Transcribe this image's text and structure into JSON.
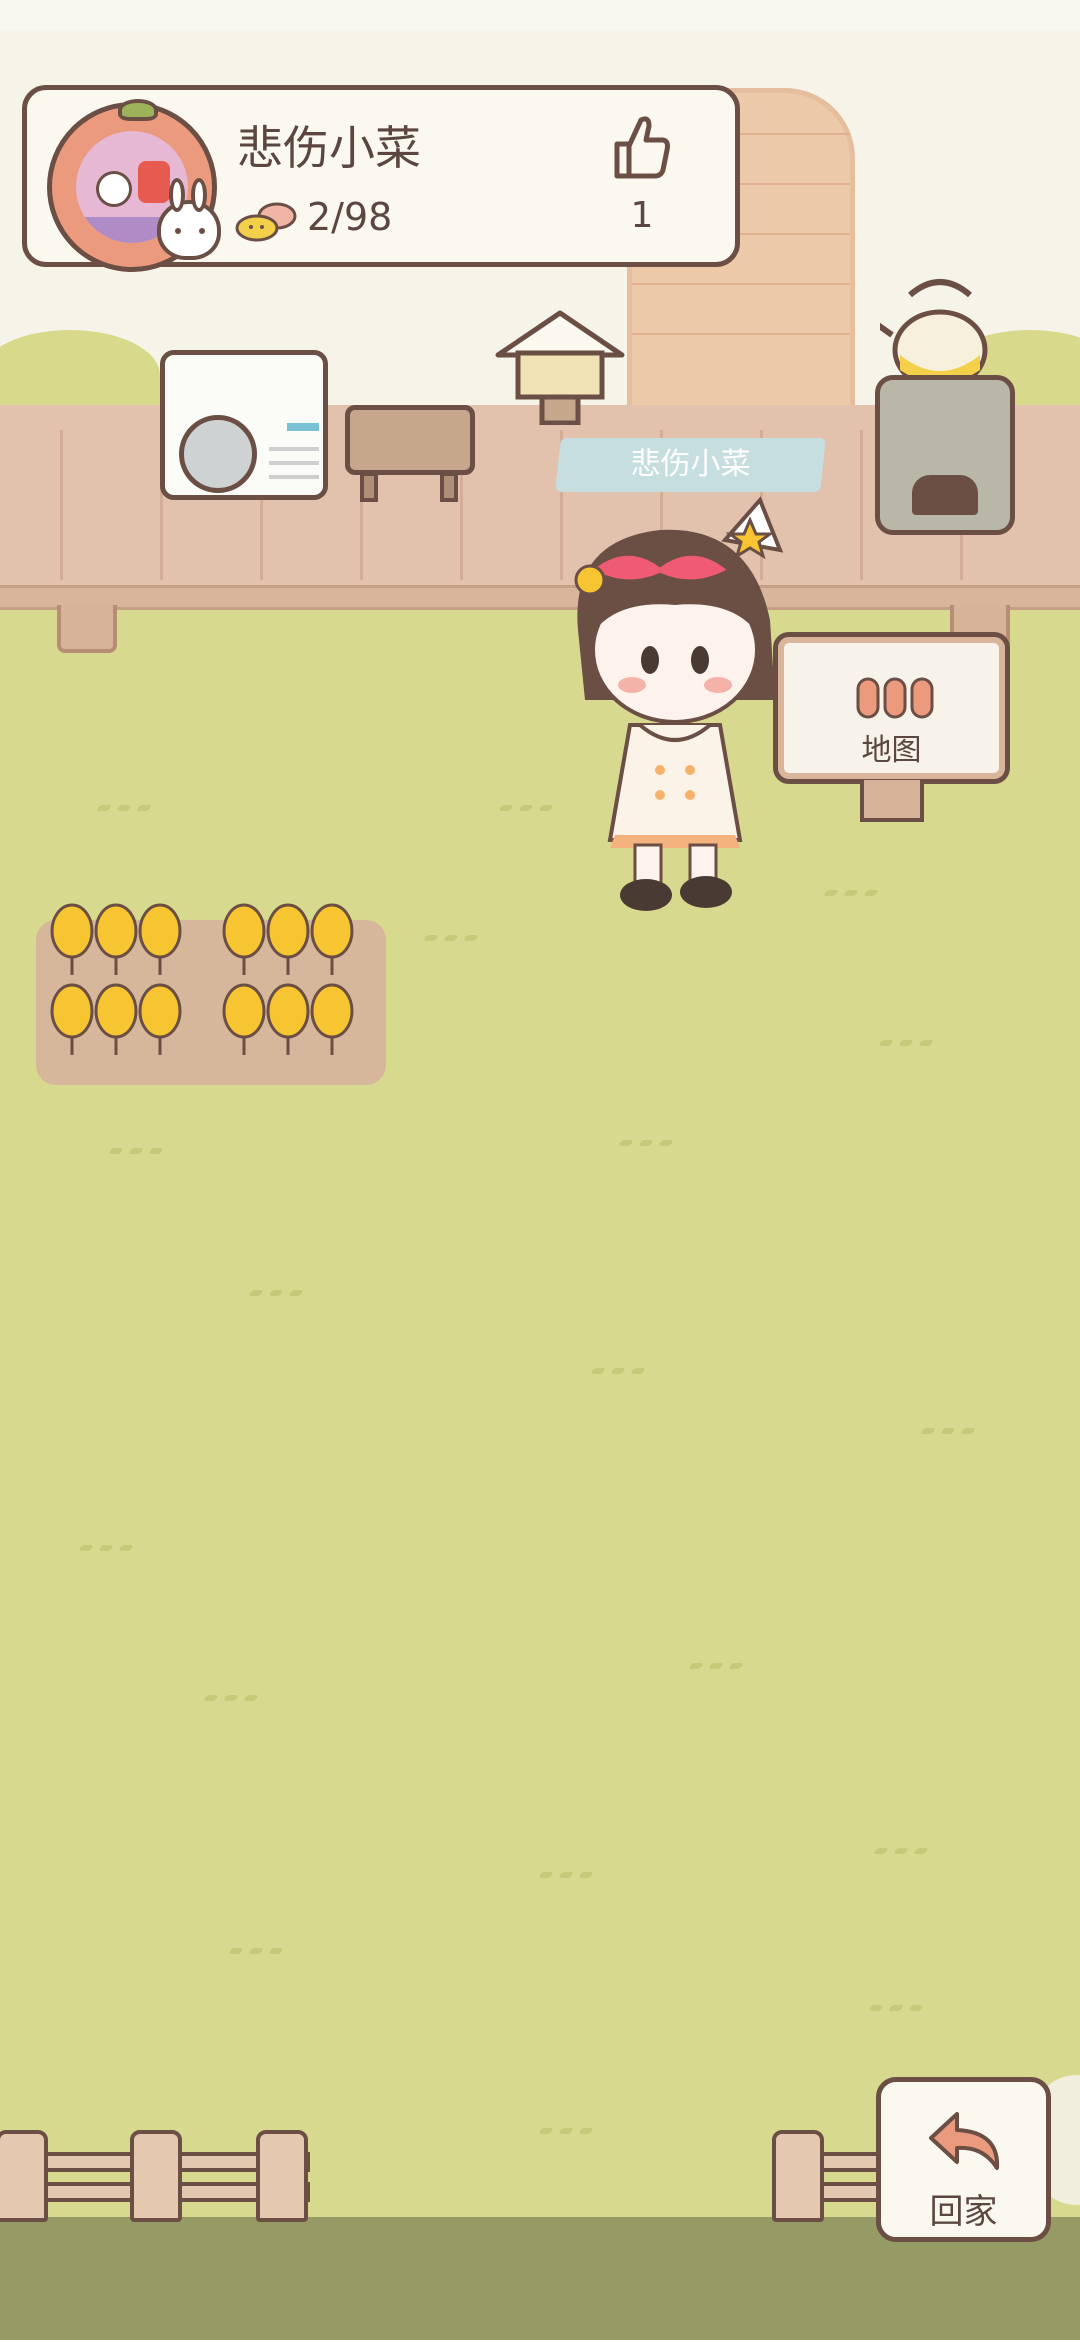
{
  "profile": {
    "player_name": "悲伤小菜",
    "seed_progress": "2/98",
    "like_count": "1"
  },
  "character": {
    "name_tag": "悲伤小菜"
  },
  "map_sign": {
    "label": "地图"
  },
  "home_button": {
    "label": "回家"
  },
  "colors": {
    "grass": "#d7da8e",
    "outline": "#6b4f45",
    "card_bg": "#fbf8f0",
    "wheat": "#f6c531",
    "name_tag": "#c6dedf"
  },
  "icons": [
    "thumbs-up-icon",
    "seed-icon",
    "map-icon",
    "return-arrow-icon",
    "bunny-icon"
  ]
}
